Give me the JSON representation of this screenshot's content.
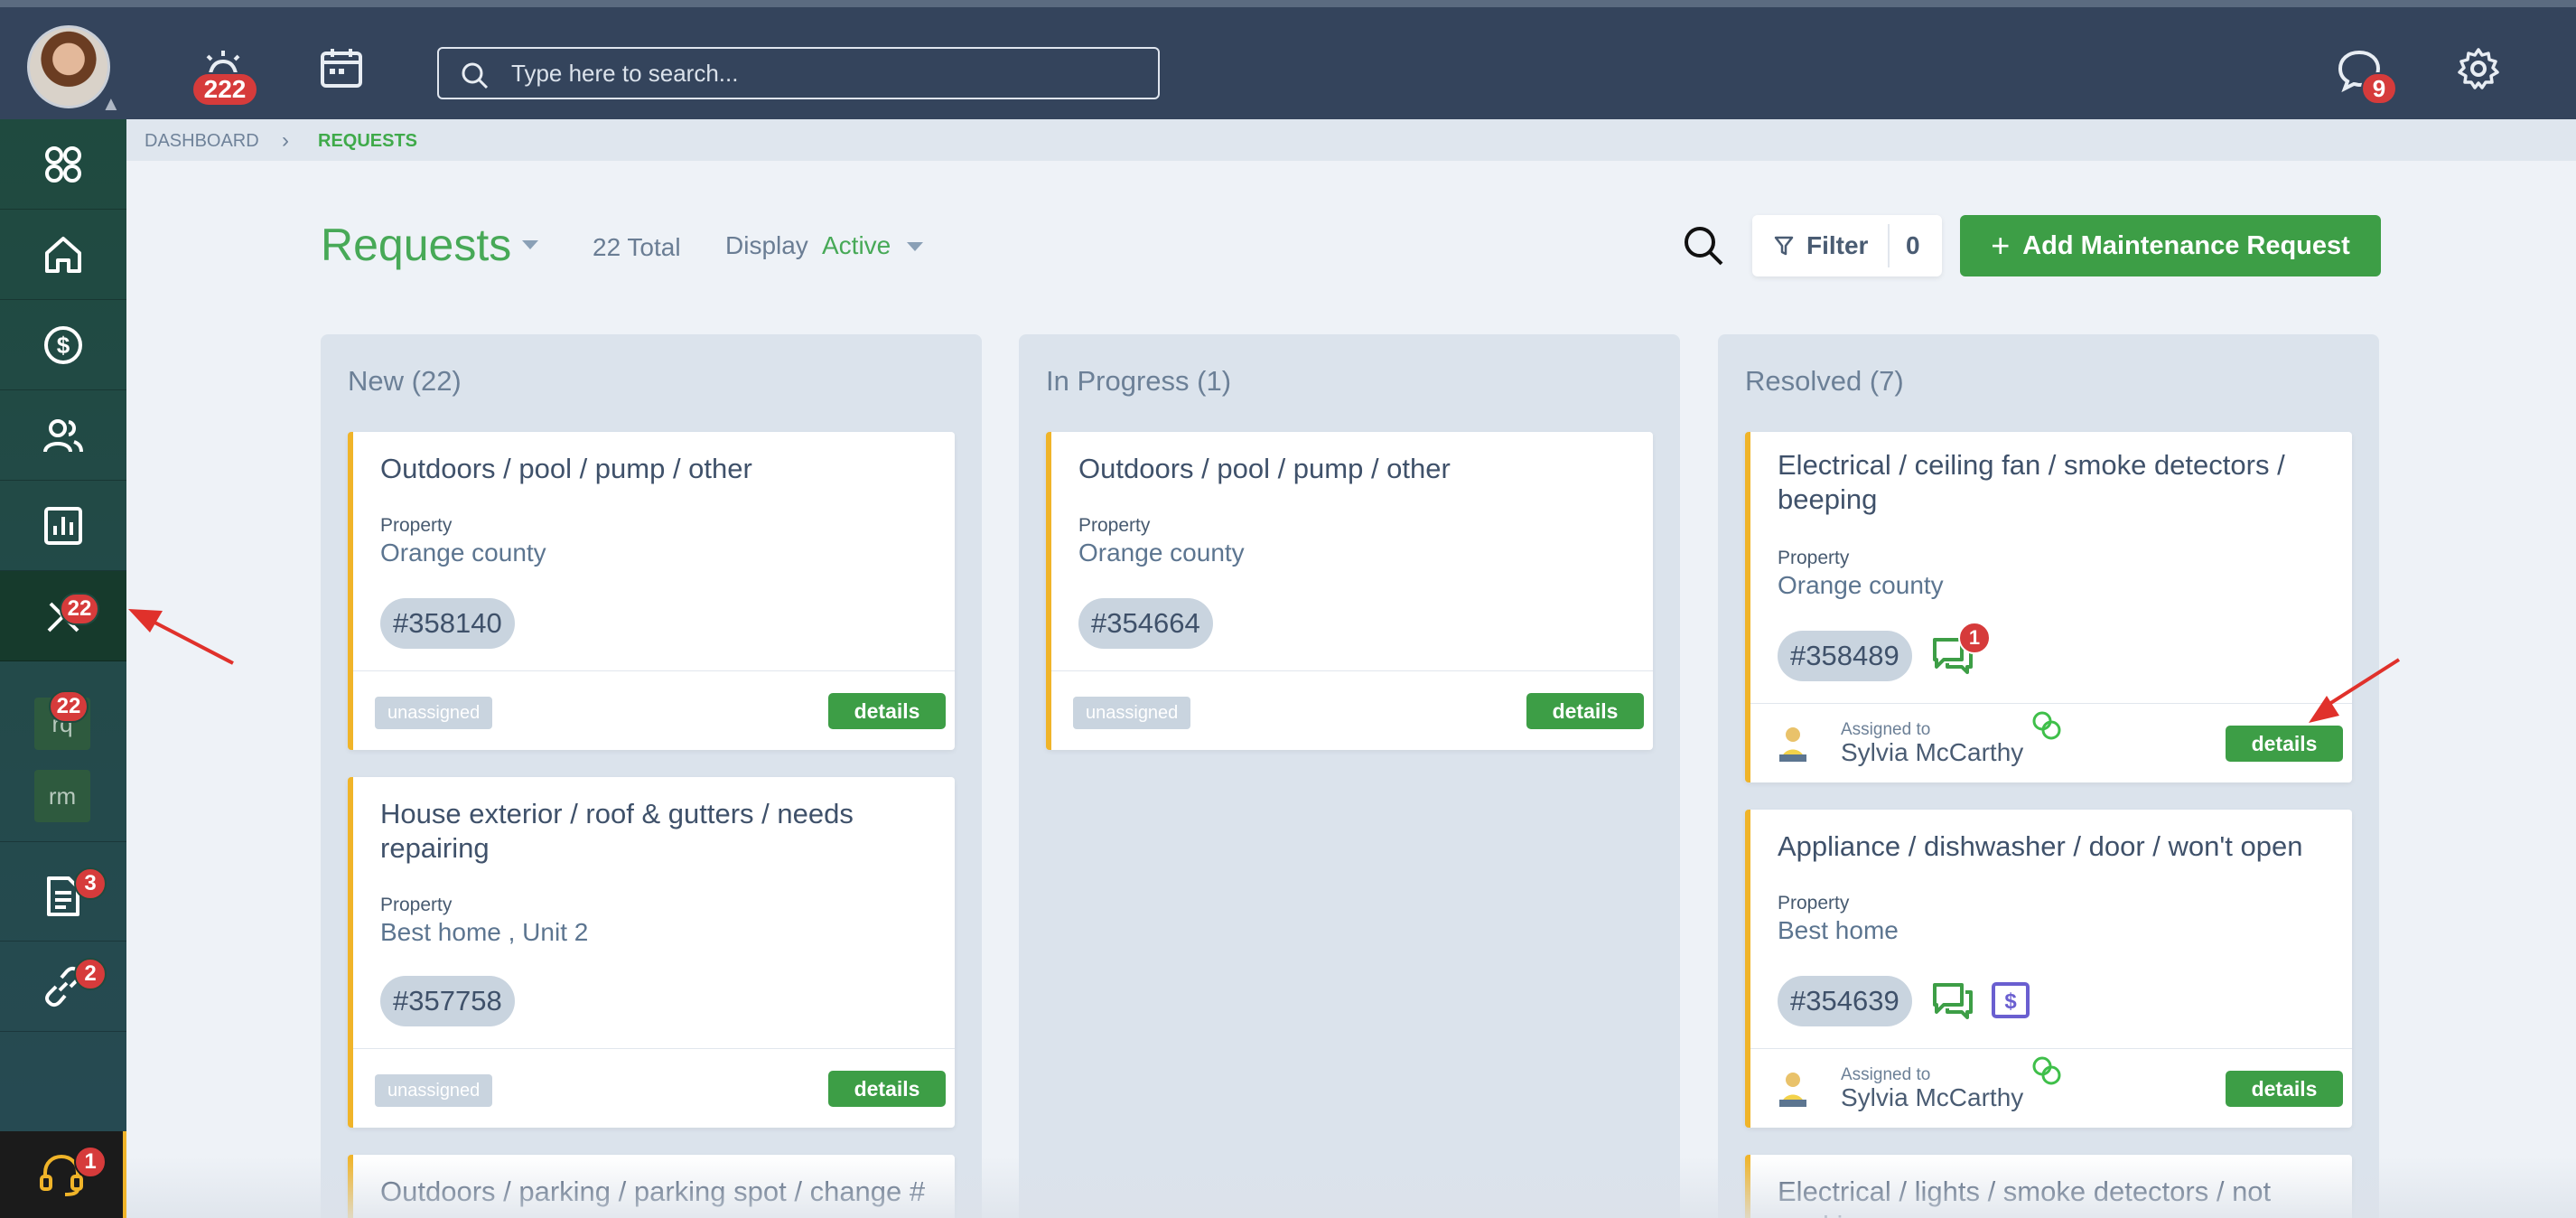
{
  "topbar": {
    "alarm_count": "222",
    "search_placeholder": "Type here to search...",
    "messages_count": "9"
  },
  "sidebar": {
    "maintenance_badge": "22",
    "rq_badge": "22",
    "rq_label": "rq",
    "rm_label": "rm",
    "documents_badge": "3",
    "links_badge": "2",
    "support_badge": "1"
  },
  "breadcrumb": {
    "dashboard": "DASHBOARD",
    "current": "REQUESTS"
  },
  "header": {
    "title": "Requests",
    "total": "22 Total",
    "display_label": "Display",
    "display_value": "Active",
    "filter_label": "Filter",
    "filter_count": "0",
    "add_button": "Add Maintenance Request"
  },
  "columns": [
    {
      "title": "New (22)",
      "cards": [
        {
          "title": "Outdoors / pool / pump / other",
          "property_label": "Property",
          "property": "Orange county",
          "ticket": "#358140",
          "status": "unassigned",
          "details": "details"
        },
        {
          "title": "House exterior / roof & gutters / needs repairing",
          "property_label": "Property",
          "property": "Best home , Unit 2",
          "ticket": "#357758",
          "status": "unassigned",
          "details": "details"
        },
        {
          "title": "Outdoors / parking / parking spot / change #"
        }
      ]
    },
    {
      "title": "In Progress (1)",
      "cards": [
        {
          "title": "Outdoors / pool / pump / other",
          "property_label": "Property",
          "property": "Orange county",
          "ticket": "#354664",
          "status": "unassigned",
          "details": "details"
        }
      ]
    },
    {
      "title": "Resolved (7)",
      "cards": [
        {
          "title": "Electrical / ceiling fan / smoke detectors / beeping",
          "property_label": "Property",
          "property": "Orange county",
          "ticket": "#358489",
          "messages_badge": "1",
          "assigned_label": "Assigned to",
          "assignee": "Sylvia McCarthy",
          "details": "details"
        },
        {
          "title": "Appliance / dishwasher / door / won't open",
          "property_label": "Property",
          "property": "Best home",
          "ticket": "#354639",
          "assigned_label": "Assigned to",
          "assignee": "Sylvia McCarthy",
          "details": "details"
        },
        {
          "title": "Electrical / lights / smoke detectors / not working"
        }
      ]
    }
  ],
  "colors": {
    "accent_green": "#3d9e46",
    "topbar": "#34445c",
    "badge_red": "#d63b3b",
    "card_stripe": "#f0b429"
  }
}
